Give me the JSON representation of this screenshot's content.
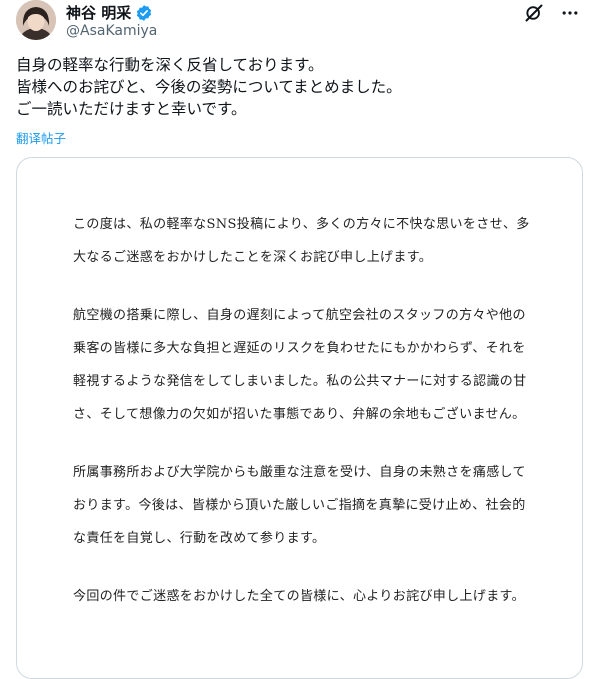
{
  "header": {
    "display_name": "神谷 明采",
    "handle": "@AsaKamiya",
    "icons": [
      "verified-badge-icon",
      "grok-icon",
      "more-icon"
    ]
  },
  "tweet": {
    "lines": [
      "自身の軽率な行動を深く反省しております。",
      "皆様へのお詫びと、今後の姿勢についてまとめました。",
      "ご一読いただけますと幸いです。"
    ],
    "translate_label": "翻译帖子"
  },
  "document": {
    "paragraphs": [
      {
        "lines": [
          "この度は、私の軽率なSNS投稿により、多くの方々に不快な思いをさせ、多",
          "大なるご迷惑をおかけしたことを深くお詫び申し上げます。"
        ]
      },
      {
        "lines": [
          "航空機の搭乗に際し、自身の遅刻によって航空会社のスタッフの方々や他の",
          "乗客の皆様に多大な負担と遅延のリスクを負わせたにもかかわらず、それを",
          "軽視するような発信をしてしまいました。私の公共マナーに対する認識の甘",
          "さ、そして想像力の欠如が招いた事態であり、弁解の余地もございません。"
        ]
      },
      {
        "lines": [
          "所属事務所および大学院からも厳重な注意を受け、自身の未熟さを痛感して",
          "おります。今後は、皆様から頂いた厳しいご指摘を真摯に受け止め、社会的",
          "な責任を自覚し、行動を改めて参ります。"
        ]
      },
      {
        "lines": [
          "今回の件でご迷惑をおかけした全ての皆様に、心よりお詫び申し上げます。"
        ]
      }
    ]
  },
  "colors": {
    "accent": "#1d9bf0",
    "text": "#0f1419",
    "muted": "#536471",
    "border": "#cfd9de"
  }
}
